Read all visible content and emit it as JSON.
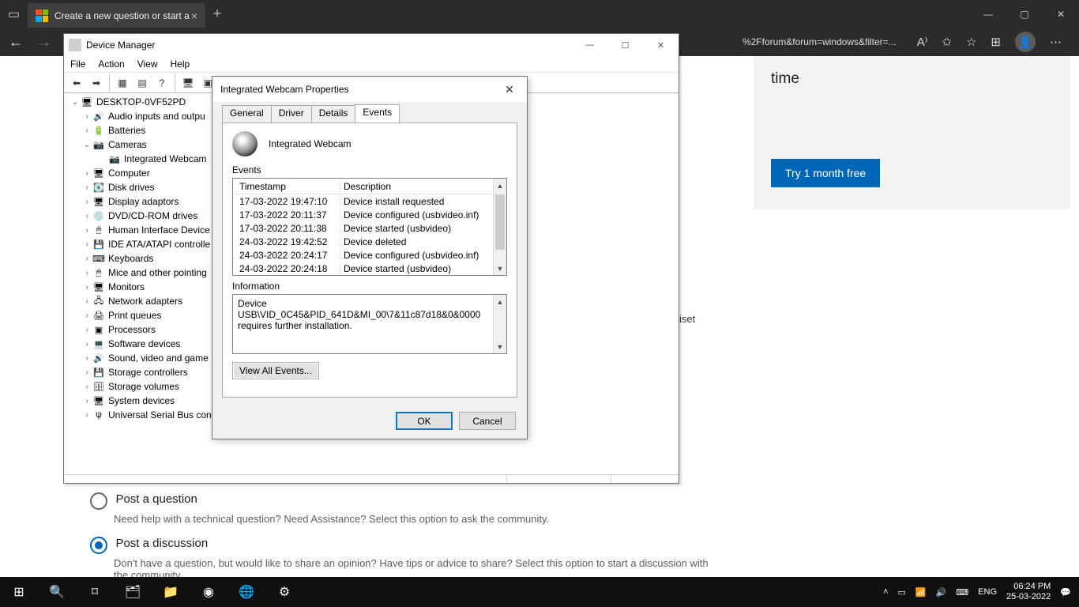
{
  "browser": {
    "tab_title": "Create a new question or start a",
    "url_fragment": "%2Fforum&forum=windows&filter=..."
  },
  "page": {
    "sidecard_text": "time",
    "sidecard_button": "Try 1 month free",
    "midword": "iset",
    "q_title": "Post a question",
    "q_sub": "Need help with a technical question? Need Assistance? Select this option to ask the community.",
    "d_title": "Post a discussion",
    "d_sub": "Don't have a question, but would like to share an opinion? Have tips or advice to share? Select this option to start a discussion with the community."
  },
  "dm": {
    "title": "Device Manager",
    "menu": [
      "File",
      "Action",
      "View",
      "Help"
    ],
    "root": "DESKTOP-0VF52PD",
    "nodes": [
      {
        "label": "Audio inputs and outpu",
        "open": false,
        "ind": 1,
        "icon": "🔊"
      },
      {
        "label": "Batteries",
        "open": false,
        "ind": 1,
        "icon": "🔋"
      },
      {
        "label": "Cameras",
        "open": true,
        "ind": 1,
        "icon": "📷"
      },
      {
        "label": "Integrated Webcam",
        "open": null,
        "ind": 2,
        "icon": "📷"
      },
      {
        "label": "Computer",
        "open": false,
        "ind": 1,
        "icon": "🖥"
      },
      {
        "label": "Disk drives",
        "open": false,
        "ind": 1,
        "icon": "💽"
      },
      {
        "label": "Display adaptors",
        "open": false,
        "ind": 1,
        "icon": "🖥"
      },
      {
        "label": "DVD/CD-ROM drives",
        "open": false,
        "ind": 1,
        "icon": "💿"
      },
      {
        "label": "Human Interface Device",
        "open": false,
        "ind": 1,
        "icon": "🖱"
      },
      {
        "label": "IDE ATA/ATAPI controlle",
        "open": false,
        "ind": 1,
        "icon": "💾"
      },
      {
        "label": "Keyboards",
        "open": false,
        "ind": 1,
        "icon": "⌨"
      },
      {
        "label": "Mice and other pointing",
        "open": false,
        "ind": 1,
        "icon": "🖱"
      },
      {
        "label": "Monitors",
        "open": false,
        "ind": 1,
        "icon": "🖥"
      },
      {
        "label": "Network adapters",
        "open": false,
        "ind": 1,
        "icon": "🖧"
      },
      {
        "label": "Print queues",
        "open": false,
        "ind": 1,
        "icon": "🖨"
      },
      {
        "label": "Processors",
        "open": false,
        "ind": 1,
        "icon": "▣"
      },
      {
        "label": "Software devices",
        "open": false,
        "ind": 1,
        "icon": "💻"
      },
      {
        "label": "Sound, video and game",
        "open": false,
        "ind": 1,
        "icon": "🔊"
      },
      {
        "label": "Storage controllers",
        "open": false,
        "ind": 1,
        "icon": "💾"
      },
      {
        "label": "Storage volumes",
        "open": false,
        "ind": 1,
        "icon": "🗄"
      },
      {
        "label": "System devices",
        "open": false,
        "ind": 1,
        "icon": "🖥"
      },
      {
        "label": "Universal Serial Bus con",
        "open": false,
        "ind": 1,
        "icon": "ψ"
      }
    ]
  },
  "prop": {
    "title": "Integrated Webcam Properties",
    "device_name": "Integrated Webcam",
    "tabs": [
      "General",
      "Driver",
      "Details",
      "Events"
    ],
    "active_tab": "Events",
    "events_label": "Events",
    "col_ts": "Timestamp",
    "col_desc": "Description",
    "rows": [
      {
        "ts": "17-03-2022 19:47:10",
        "d": "Device install requested"
      },
      {
        "ts": "17-03-2022 20:11:37",
        "d": "Device configured (usbvideo.inf)"
      },
      {
        "ts": "17-03-2022 20:11:38",
        "d": "Device started (usbvideo)"
      },
      {
        "ts": "24-03-2022 19:42:52",
        "d": "Device deleted"
      },
      {
        "ts": "24-03-2022 20:24:17",
        "d": "Device configured (usbvideo.inf)"
      },
      {
        "ts": "24-03-2022 20:24:18",
        "d": "Device started (usbvideo)"
      }
    ],
    "info_label": "Information",
    "info_text": "Device USB\\VID_0C45&PID_641D&MI_00\\7&11c87d18&0&0000 requires further installation.",
    "view_all": "View All Events...",
    "ok": "OK",
    "cancel": "Cancel"
  },
  "taskbar": {
    "lang": "ENG",
    "time": "06:24 PM",
    "date": "25-03-2022"
  }
}
